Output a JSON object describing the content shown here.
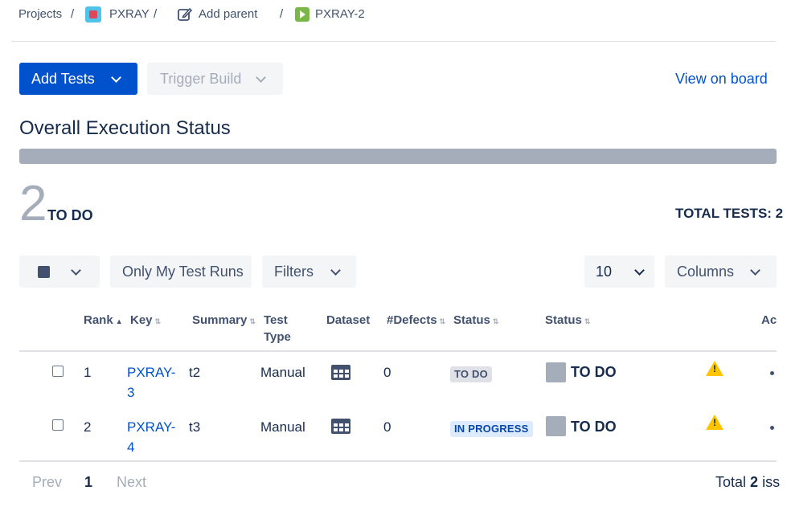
{
  "breadcrumb": {
    "projects": "Projects",
    "sep": "/",
    "project": "PXRAY",
    "add_parent": "Add parent",
    "issue": "PXRAY-2"
  },
  "toolbar": {
    "add_tests": "Add Tests",
    "trigger_build": "Trigger Build",
    "view_on_board": "View on board"
  },
  "overall": {
    "title": "Overall Execution Status",
    "count": "2",
    "count_label": "TO DO",
    "total_label": "TOTAL TESTS: 2"
  },
  "filters": {
    "only_my": "Only My Test Runs",
    "filters": "Filters",
    "page_size": "10",
    "columns": "Columns"
  },
  "table": {
    "headers": {
      "rank": "Rank",
      "key": "Key",
      "summary": "Summary",
      "test_type_1": "Test",
      "test_type_2": "Type",
      "dataset": "Dataset",
      "defects": "#Defects",
      "status1": "Status",
      "status2": "Status",
      "actions": "Ac"
    },
    "rows": [
      {
        "rank": "1",
        "key_1": "PXRAY-",
        "key_2": "3",
        "summary": "t2",
        "type": "Manual",
        "defects": "0",
        "test_status": "TO DO",
        "run_status": "TO DO"
      },
      {
        "rank": "2",
        "key_1": "PXRAY-",
        "key_2": "4",
        "summary": "t3",
        "type": "Manual",
        "defects": "0",
        "test_status": "IN PROGRESS",
        "run_status": "TO DO"
      }
    ]
  },
  "pagination": {
    "prev": "Prev",
    "page": "1",
    "next": "Next",
    "total_prefix": "Total",
    "total_count": "2",
    "total_suffix": "iss"
  },
  "colors": {
    "primary": "#0052cc",
    "todo_gray": "#a5adba",
    "in_progress_bg": "#deebff",
    "warning": "#ffc400"
  }
}
